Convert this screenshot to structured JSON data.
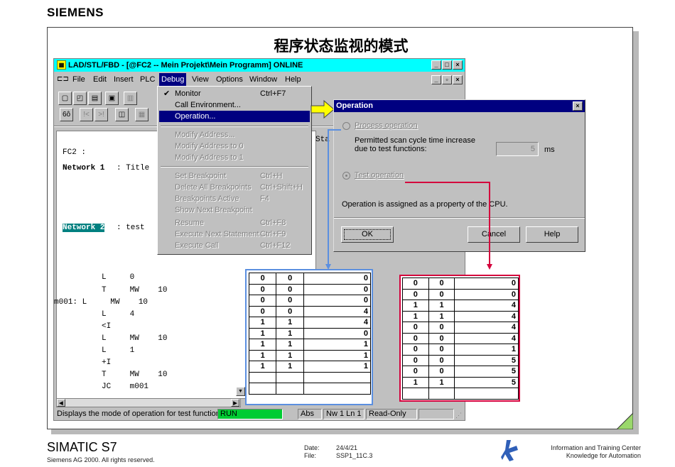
{
  "brand": "SIEMENS",
  "slide_title": "程序状态监视的模式",
  "app": {
    "title": "LAD/STL/FBD  - [@FC2 -- Mein Projekt\\Mein Programm]  ONLINE",
    "menu": [
      "File",
      "Edit",
      "Insert",
      "PLC",
      "Debug",
      "View",
      "Options",
      "Window",
      "Help"
    ],
    "toolbar_glyphs": [
      "▢",
      "◰",
      "▤",
      "▣",
      "▥",
      "⊕",
      "⊗",
      "◫",
      "▦",
      "✚"
    ]
  },
  "debug_menu": {
    "items": [
      {
        "label": "Monitor",
        "shortcut": "Ctrl+F7",
        "checked": "✔"
      },
      {
        "label": "Call Environment...",
        "shortcut": ""
      },
      {
        "label": "Operation...",
        "shortcut": ""
      },
      {
        "label": "Modify Address...",
        "shortcut": ""
      },
      {
        "label": "Modify Address to 0",
        "shortcut": ""
      },
      {
        "label": "Modify Address to 1",
        "shortcut": ""
      },
      {
        "label": "Set Breakpoint",
        "shortcut": "Ctrl+H"
      },
      {
        "label": "Delete All Breakpoints",
        "shortcut": "Ctrl+Shift+H"
      },
      {
        "label": "Breakpoints Active",
        "shortcut": "F4"
      },
      {
        "label": "Show Next Breakpoint",
        "shortcut": ""
      },
      {
        "label": "Resume",
        "shortcut": "Ctrl+F8"
      },
      {
        "label": "Execute Next Statement",
        "shortcut": "Ctrl+F9"
      },
      {
        "label": "Execute Call",
        "shortcut": "Ctrl+F12"
      }
    ]
  },
  "editor": {
    "fc_label": "FC2 :",
    "network1": "Network 1",
    "network1_rest": ": Title",
    "network2": "Network 2",
    "network2_rest": ": test",
    "sta_header": "Sta",
    "lines": [
      "     L     0",
      "     T     MW    10",
      "m001: L     MW    10",
      "     L     4",
      "     <I",
      "     L     MW    10",
      "     L     1",
      "     +I",
      "     T     MW    10",
      "     JC    m001"
    ]
  },
  "dialog": {
    "title": "Operation",
    "process_label": "Process operation",
    "scan_text_1": "Permitted scan cycle time increase",
    "scan_text_2": "due to test functions:",
    "scan_value": "5",
    "scan_unit": "ms",
    "test_label": "Test operation",
    "info": "Operation is assigned as a property of the CPU.",
    "ok": "OK",
    "cancel": "Cancel",
    "help": "Help"
  },
  "status": {
    "text": "Displays the mode of operation for test functions.",
    "run": "RUN",
    "abs": "Abs",
    "pos": "Nw 1  Ln 1",
    "mode": "Read-Only"
  },
  "table_process": [
    [
      "0",
      "0",
      "0"
    ],
    [
      "0",
      "0",
      "0"
    ],
    [
      "0",
      "0",
      "0"
    ],
    [
      "0",
      "0",
      "4"
    ],
    [
      "1",
      "1",
      "4"
    ],
    [
      "1",
      "1",
      "0"
    ],
    [
      "1",
      "1",
      "1"
    ],
    [
      "1",
      "1",
      "1"
    ],
    [
      "1",
      "1",
      "1"
    ],
    [
      "",
      "",
      " "
    ],
    [
      "",
      "",
      " "
    ]
  ],
  "table_test": [
    [
      "0",
      "0",
      "0"
    ],
    [
      "0",
      "0",
      "0"
    ],
    [
      "1",
      "1",
      "4"
    ],
    [
      "1",
      "1",
      "4"
    ],
    [
      "0",
      "0",
      "4"
    ],
    [
      "0",
      "0",
      "4"
    ],
    [
      "0",
      "0",
      "1"
    ],
    [
      "0",
      "0",
      "5"
    ],
    [
      "0",
      "0",
      "5"
    ],
    [
      "1",
      "1",
      "5"
    ],
    [
      "",
      "",
      " "
    ]
  ],
  "footer": {
    "product": "SIMATIC S7",
    "copyright": "Siemens AG 2000. All rights reserved.",
    "date_label": "Date:",
    "date_value": "24/4/21",
    "file_label": "File:",
    "file_value": "SSP1_11C.3",
    "center_1": "Information and Training Center",
    "center_2": "Knowledge for Automation"
  },
  "colors": {
    "titlebar": "#00ffff",
    "selection": "#000080",
    "run": "#00cc33",
    "blue_frame": "#5b8fe0",
    "red_frame": "#d4003c",
    "arrow": "#ffff00"
  }
}
